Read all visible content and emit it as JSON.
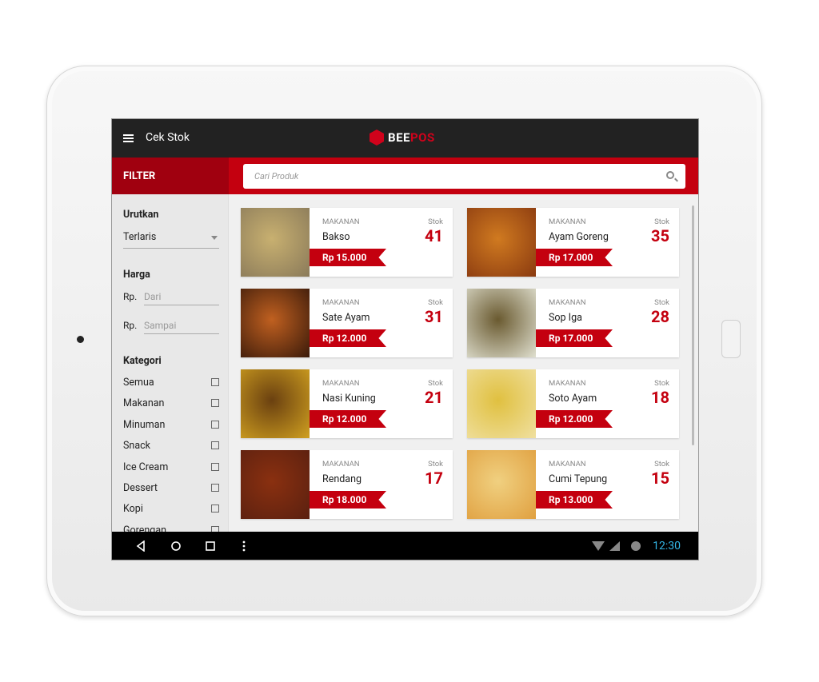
{
  "header": {
    "title": "Cek Stok",
    "logo_a": "BEE",
    "logo_b": "POS"
  },
  "filter": {
    "title": "FILTER",
    "sort_label": "Urutkan",
    "sort_value": "Terlaris",
    "price_label": "Harga",
    "from_prefix": "Rp.",
    "from_placeholder": "Dari",
    "to_prefix": "Rp.",
    "to_placeholder": "Sampai",
    "category_label": "Kategori",
    "categories": [
      "Semua",
      "Makanan",
      "Minuman",
      "Snack",
      "Ice Cream",
      "Dessert",
      "Kopi",
      "Gorengan"
    ]
  },
  "search": {
    "placeholder": "Cari Produk"
  },
  "stock_label": "Stok",
  "products": [
    {
      "category": "MAKANAN",
      "name": "Bakso",
      "stock": "41",
      "price": "Rp 15.000",
      "c1": "#8a7a5a",
      "c2": "#c8b070"
    },
    {
      "category": "MAKANAN",
      "name": "Ayam Goreng",
      "stock": "35",
      "price": "Rp 17.000",
      "c1": "#8a3a10",
      "c2": "#d07a20"
    },
    {
      "category": "MAKANAN",
      "name": "Sate Ayam",
      "stock": "31",
      "price": "Rp 12.000",
      "c1": "#3a1a0a",
      "c2": "#c06020"
    },
    {
      "category": "MAKANAN",
      "name": "Sop Iga",
      "stock": "28",
      "price": "Rp 17.000",
      "c1": "#e0e0d0",
      "c2": "#6a5a30"
    },
    {
      "category": "MAKANAN",
      "name": "Nasi Kuning",
      "stock": "21",
      "price": "Rp 12.000",
      "c1": "#d0a020",
      "c2": "#6a4010"
    },
    {
      "category": "MAKANAN",
      "name": "Soto Ayam",
      "stock": "18",
      "price": "Rp 12.000",
      "c1": "#f0e0a0",
      "c2": "#e0c040"
    },
    {
      "category": "MAKANAN",
      "name": "Rendang",
      "stock": "17",
      "price": "Rp 18.000",
      "c1": "#5a2010",
      "c2": "#8a3010"
    },
    {
      "category": "MAKANAN",
      "name": "Cumi Tepung",
      "stock": "15",
      "price": "Rp 13.000",
      "c1": "#e0a040",
      "c2": "#f0d080"
    }
  ],
  "statusbar": {
    "time": "12:30"
  },
  "colors": {
    "primary": "#c4000f",
    "dark": "#222222",
    "clock": "#33b5e5"
  }
}
